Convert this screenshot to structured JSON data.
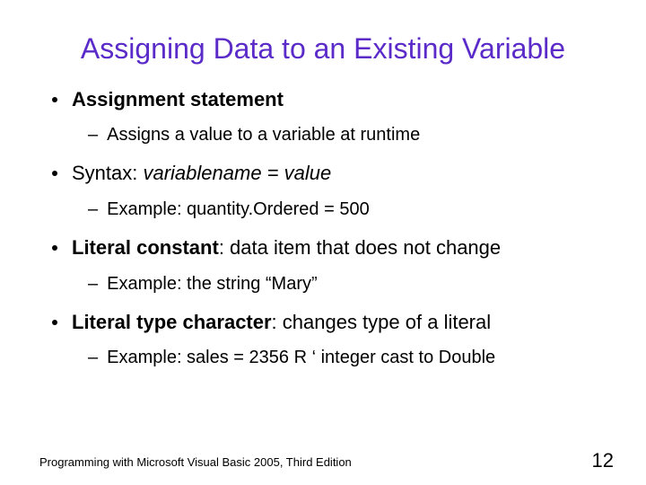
{
  "title": "Assigning Data to an Existing Variable",
  "bullets": [
    {
      "prefix_bold": "Assignment statement",
      "rest": "",
      "sub": [
        {
          "text": "Assigns a value to a variable at runtime"
        }
      ]
    },
    {
      "plain_before": "Syntax: ",
      "italic": "variablename = value",
      "sub": [
        {
          "text": "Example: quantity.Ordered = 500"
        }
      ]
    },
    {
      "prefix_bold": "Literal constant",
      "rest": ": data item that does not change",
      "sub": [
        {
          "text": "Example: the string “Mary”"
        }
      ]
    },
    {
      "prefix_bold": "Literal type character",
      "rest": ": changes type of a literal",
      "sub": [
        {
          "text": "Example: sales = 2356 R ‘ integer cast to Double"
        }
      ]
    }
  ],
  "footer": "Programming with Microsoft Visual Basic 2005, Third Edition",
  "page_number": "12"
}
